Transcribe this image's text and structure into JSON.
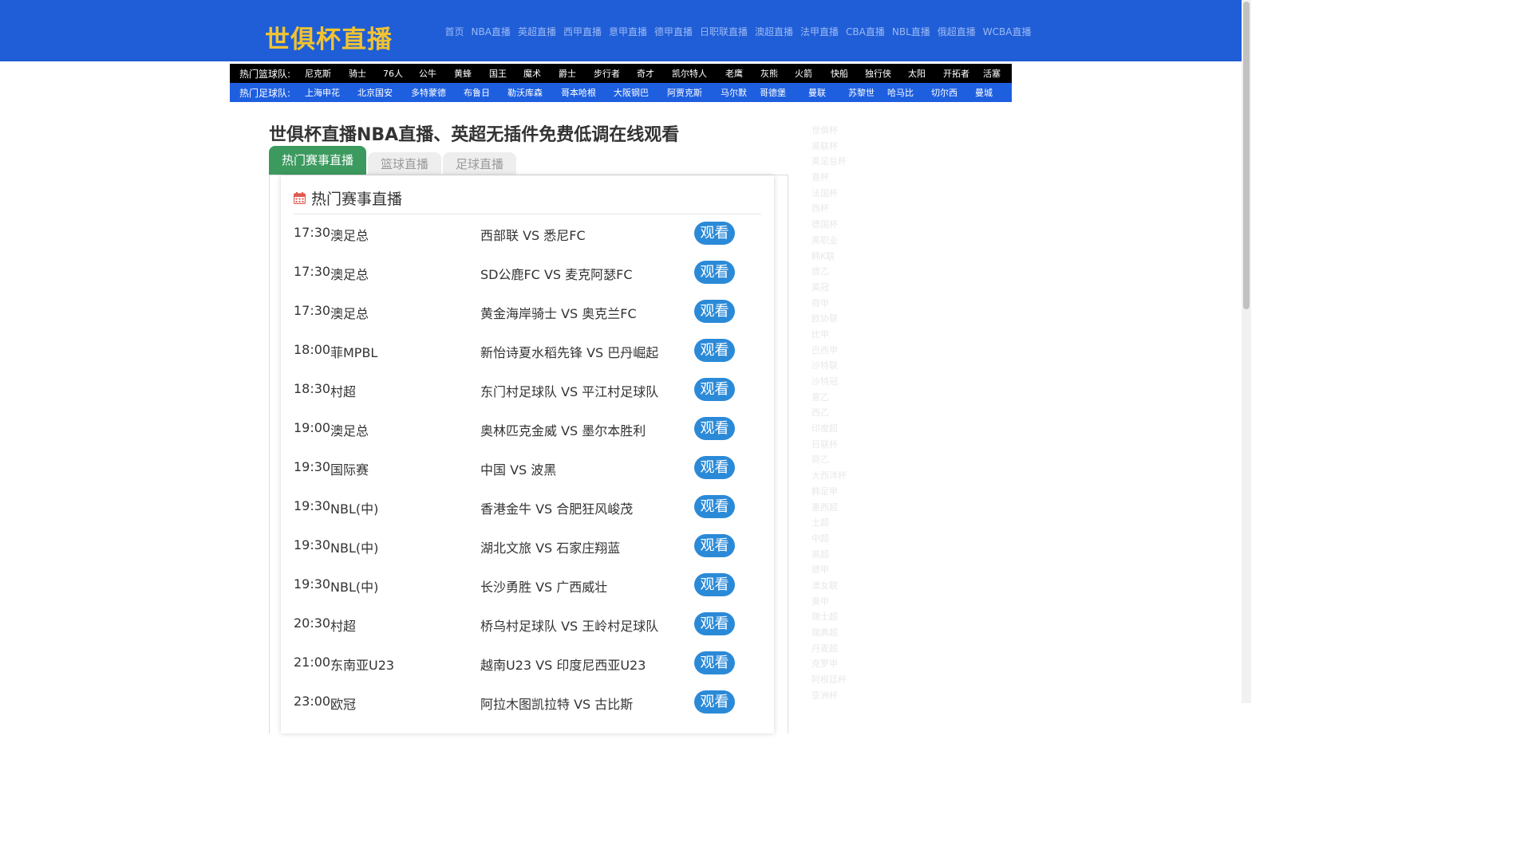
{
  "header": {
    "logo": "世俱杯直播",
    "nav": [
      "首页",
      "NBA直播",
      "英超直播",
      "西甲直播",
      "意甲直播",
      "德甲直播",
      "日职联直播",
      "澳超直播",
      "法甲直播",
      "CBA直播",
      "NBL直播",
      "俄超直播",
      "WCBA直播"
    ]
  },
  "basketball_bar": {
    "label": "热门篮球队:",
    "teams": [
      "尼克斯",
      "骑士",
      "76人",
      "公牛",
      "黄蜂",
      "国王",
      "魔术",
      "爵士",
      "步行者",
      "奇才",
      "凯尔特人",
      "老鹰",
      "灰熊",
      "火箭",
      "快船",
      "独行侠",
      "太阳",
      "开拓者",
      "活塞"
    ]
  },
  "football_bar": {
    "label": "热门足球队:",
    "teams": [
      "上海申花",
      "北京国安",
      "多特蒙德",
      "布鲁日",
      "勒沃库森",
      "哥本哈根",
      "大阪钢巴",
      "阿贾克斯",
      "马尔默",
      "哥德堡",
      "曼联",
      "苏黎世",
      "哈马比",
      "切尔西",
      "曼城"
    ]
  },
  "page_title": "世俱杯直播NBA直播、英超无插件免费低调在线观看",
  "tabs": [
    "热门赛事直播",
    "篮球直播",
    "足球直播"
  ],
  "panel_title": "热门赛事直播",
  "watch_label": "观看",
  "matches": [
    {
      "time": "17:30",
      "league": "澳足总",
      "match": "西部联 VS 悉尼FC"
    },
    {
      "time": "17:30",
      "league": "澳足总",
      "match": "SD公鹿FC VS 麦克阿瑟FC"
    },
    {
      "time": "17:30",
      "league": "澳足总",
      "match": "黄金海岸骑士 VS 奥克兰FC"
    },
    {
      "time": "18:00",
      "league": "菲MPBL",
      "match": "新怡诗夏水稻先锋 VS 巴丹崛起"
    },
    {
      "time": "18:30",
      "league": "村超",
      "match": "东门村足球队 VS 平江村足球队"
    },
    {
      "time": "19:00",
      "league": "澳足总",
      "match": "奥林匹克金威 VS 墨尔本胜利"
    },
    {
      "time": "19:30",
      "league": "国际赛",
      "match": "中国 VS 波黑"
    },
    {
      "time": "19:30",
      "league": "NBL(中)",
      "match": "香港金牛 VS 合肥狂风峻茂"
    },
    {
      "time": "19:30",
      "league": "NBL(中)",
      "match": "湖北文旅 VS 石家庄翔蓝"
    },
    {
      "time": "19:30",
      "league": "NBL(中)",
      "match": "长沙勇胜 VS 广西威壮"
    },
    {
      "time": "20:30",
      "league": "村超",
      "match": "桥乌村足球队 VS 王岭村足球队"
    },
    {
      "time": "21:00",
      "league": "东南亚U23",
      "match": "越南U23 VS 印度尼西亚U23"
    },
    {
      "time": "23:00",
      "league": "欧冠",
      "match": "阿拉木图凯拉特 VS 古比斯"
    }
  ],
  "sidebar": [
    "世俱杯",
    "英联杯",
    "英足总杯",
    "意杯",
    "法国杯",
    "西杯",
    "德国杯",
    "英职业",
    "韩K联",
    "德乙",
    "英冠",
    "荷甲",
    "欧协联",
    "比甲",
    "巴西甲",
    "沙特联",
    "沙特冠",
    "意乙",
    "西乙",
    "印度超",
    "日联杯",
    "荷乙",
    "大西洋杯",
    "韩足甲",
    "墨西超",
    "土超",
    "中超",
    "英超",
    "德甲",
    "澳女联",
    "美甲",
    "瑞士超",
    "瑞典超",
    "丹麦超",
    "克罗甲",
    "阿根廷杯",
    "亚洲杯"
  ],
  "colors": {
    "header": "#1f5ed6",
    "logo": "#f1c232",
    "active_tab": "#3c9a5f",
    "button": "#2b8ad8",
    "football_bar": "#1e5fe0"
  }
}
